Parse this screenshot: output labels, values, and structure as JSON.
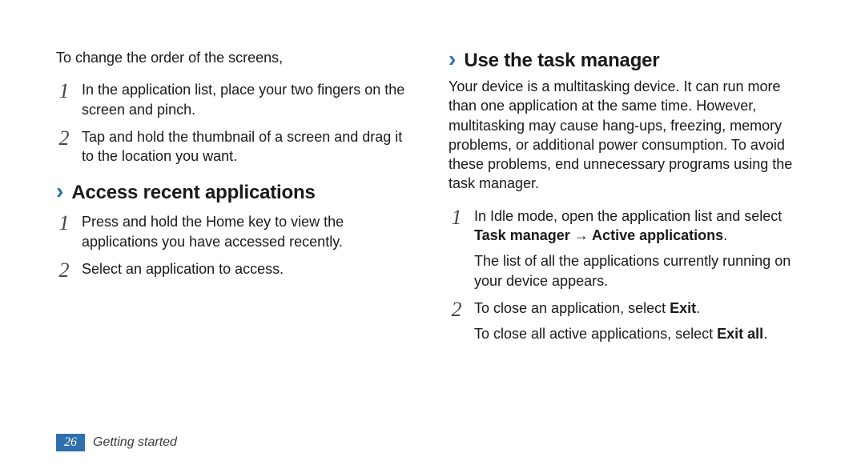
{
  "left": {
    "intro": "To change the order of the screens,",
    "stepsA": [
      "In the application list, place your two fingers on the screen and pinch.",
      "Tap and hold the thumbnail of a screen and drag it to the location you want."
    ],
    "headingA": "Access recent applications",
    "stepsB": [
      "Press and hold the Home key to view the applications you have accessed recently.",
      "Select an application to access."
    ]
  },
  "right": {
    "heading": "Use the task manager",
    "intro": "Your device is a multitasking device. It can run more than one application at the same time. However, multitasking may cause hang-ups, freezing, memory problems, or additional power consumption. To avoid these problems, end unnecessary programs using the task manager.",
    "step1": {
      "line1_pre": "In Idle mode, open the application list and select ",
      "line1_bold": "Task manager → Active applications",
      "line1_post": ".",
      "line2": "The list of all the applications currently running on your device appears."
    },
    "step2": {
      "line1_pre": "To close an application, select ",
      "line1_bold": "Exit",
      "line1_post": ".",
      "line2_pre": "To close all active applications, select ",
      "line2_bold": "Exit all",
      "line2_post": "."
    }
  },
  "footer": {
    "page": "26",
    "section": "Getting started"
  }
}
